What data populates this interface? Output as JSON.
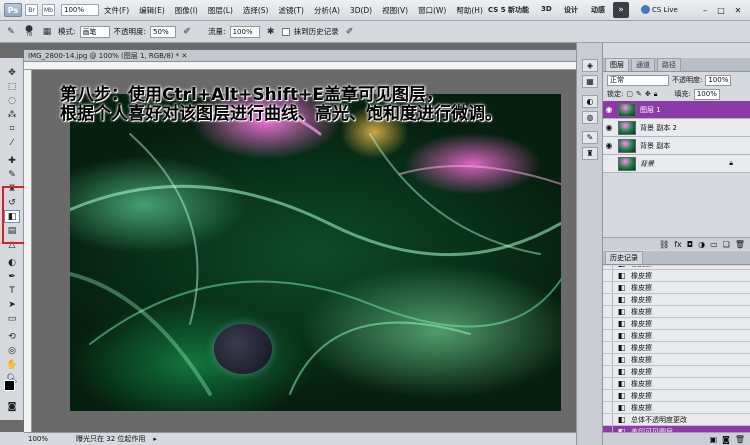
{
  "menubar": {
    "logo": "Ps",
    "mini_buttons": [
      "Br",
      "Mb"
    ],
    "items": [
      "文件(F)",
      "编辑(E)",
      "图像(I)",
      "图层(L)",
      "选择(S)",
      "滤镜(T)",
      "分析(A)",
      "3D(D)",
      "视图(V)",
      "窗口(W)",
      "帮助(H)"
    ],
    "zoom": "100%",
    "workspaces": [
      "CS 5 新功能",
      "3D",
      "设计",
      "动感"
    ],
    "more": "»",
    "cs_live": "CS Live",
    "window_controls": [
      "–",
      "□",
      "✕"
    ]
  },
  "options": {
    "size": "78",
    "mode_label": "模式:",
    "mode_value": "画笔",
    "opacity_label": "不透明度:",
    "opacity_value": "50%",
    "flow_label": "流量:",
    "flow_value": "100%",
    "history_label": "抹到历史记录"
  },
  "document": {
    "tab_title": "IMG_2800-14.jpg @ 100% (图层 1, RGB/8) * ✕",
    "overlay_line1": "第八步：使用Ctrl+Alt+Shift+E盖章可见图层，",
    "overlay_line2": "根据个人喜好对该图层进行曲线、高光、饱和度进行微调。"
  },
  "status": {
    "zoom": "100%",
    "info": "曝光只在 32 位起作用"
  },
  "layers_panel": {
    "tabs": [
      "图层",
      "通道",
      "路径"
    ],
    "blend_mode": "正常",
    "opacity_label": "不透明度:",
    "opacity_value": "100%",
    "lock_label": "锁定:",
    "fill_label": "填充:",
    "fill_value": "100%",
    "layers": [
      {
        "name": "图层 1",
        "selected": true,
        "visible": true
      },
      {
        "name": "背景 副本 2",
        "selected": false,
        "visible": true
      },
      {
        "name": "背景 副本",
        "selected": false,
        "visible": true
      },
      {
        "name": "背景",
        "selected": false,
        "visible": false,
        "locked": true
      }
    ],
    "footer_icons": [
      "link-icon",
      "fx-icon",
      "mask-icon",
      "adjustment-icon",
      "folder-icon",
      "new-layer-icon",
      "trash-icon"
    ]
  },
  "history_panel": {
    "tab": "历史记录",
    "items": [
      "橡皮擦",
      "橡皮擦",
      "橡皮擦",
      "橡皮擦",
      "橡皮擦",
      "橡皮擦",
      "橡皮擦",
      "橡皮擦",
      "橡皮擦",
      "橡皮擦",
      "橡皮擦",
      "橡皮擦",
      "橡皮擦",
      "总体不透明度更改",
      "盖印可见图层"
    ],
    "selected_index": 14
  },
  "colors": {
    "highlight_box": "#e02020",
    "selected_row": "#8b3aa8"
  }
}
